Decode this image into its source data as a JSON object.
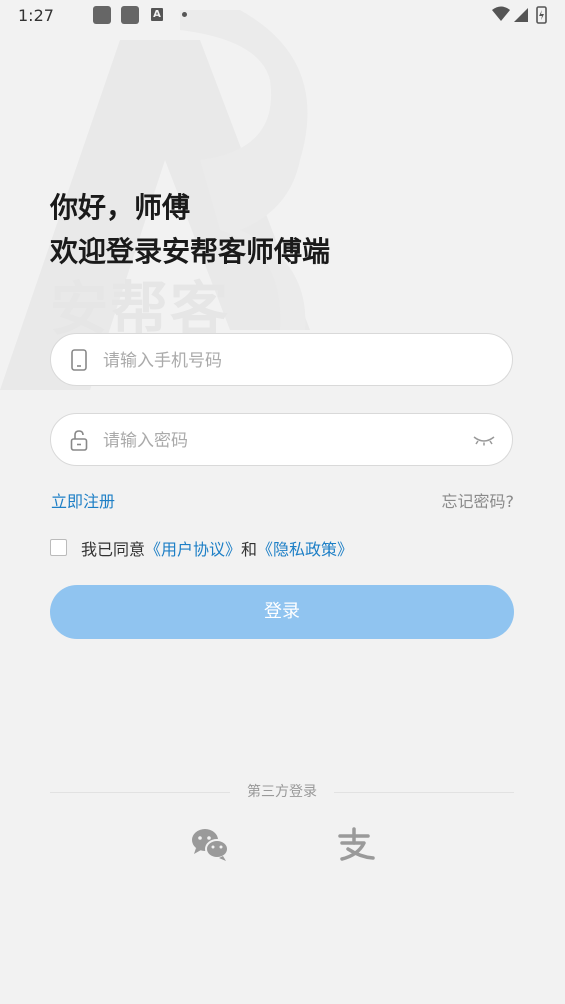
{
  "status_bar": {
    "time": "1:27"
  },
  "watermark": {
    "brand_text": "安帮客"
  },
  "greeting": {
    "line1": "你好，师傅",
    "line2": "欢迎登录安帮客师傅端"
  },
  "phone_field": {
    "placeholder": "请输入手机号码",
    "value": ""
  },
  "password_field": {
    "placeholder": "请输入密码",
    "value": ""
  },
  "links": {
    "register": "立即注册",
    "forgot": "忘记密码?"
  },
  "agreement": {
    "prefix": "我已同意",
    "user_agreement": "《用户协议》",
    "and": "和",
    "privacy_policy": "《隐私政策》",
    "checked": false
  },
  "login_button": {
    "label": "登录"
  },
  "third_party": {
    "title": "第三方登录",
    "options": [
      "wechat-icon",
      "alipay-icon"
    ]
  },
  "colors": {
    "accent": "#1d7fc6",
    "button": "#90c4f0",
    "background": "#f2f2f2"
  }
}
